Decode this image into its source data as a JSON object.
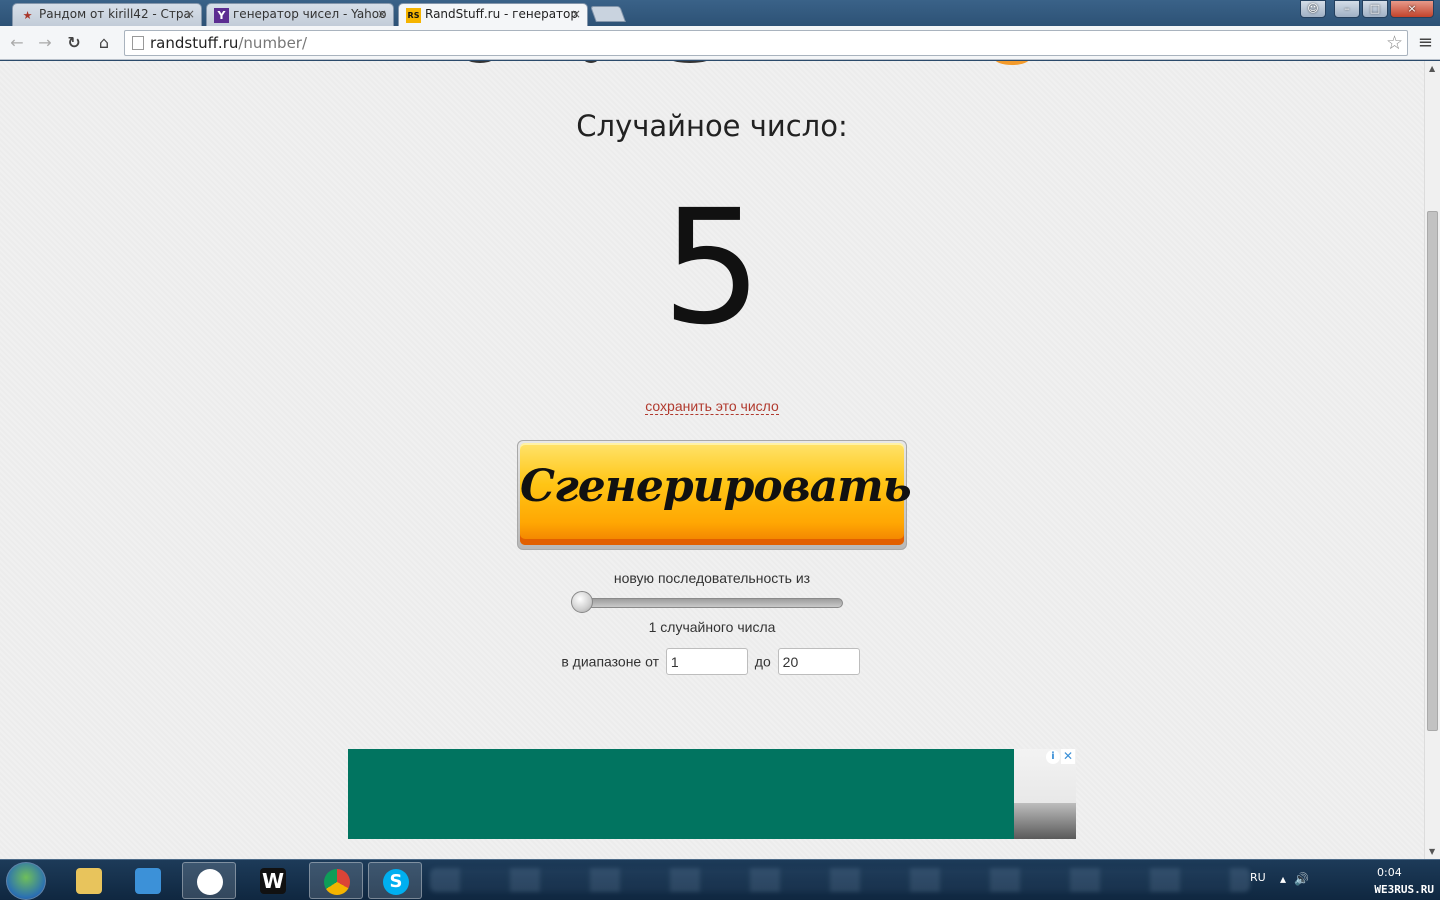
{
  "browser": {
    "tabs": [
      {
        "title": "Рандом от kirill42 - Стра",
        "favicon": "star-icon",
        "active": false
      },
      {
        "title": "генератор чисел - Yahoo",
        "favicon": "Y",
        "active": false
      },
      {
        "title": "RandStuff.ru - генератор",
        "favicon": "RS",
        "active": true
      }
    ],
    "tab_close": "×",
    "url_host": "randstuff.ru",
    "url_path": "/number/",
    "window_controls": {
      "minimize": "–",
      "maximize": "□",
      "close": "×"
    }
  },
  "page": {
    "heading": "Случайное число:",
    "number": "5",
    "save_link": "сохранить это число",
    "generate_button": "Сгенерировать",
    "sequence_label": "новую последовательность из",
    "count_label": "1 случайного числа",
    "slider": {
      "value": 1
    },
    "range": {
      "from_label": "в диапазоне от",
      "from_value": "1",
      "to_label": "до",
      "to_value": "20"
    },
    "ad": {
      "info": "i",
      "close": "✕"
    }
  },
  "taskbar": {
    "w_app": "W",
    "skype": "S",
    "lang": "RU",
    "clock": "0:04",
    "watermark": "WE3RUS.RU"
  },
  "colors": {
    "accent_orange": "#ffb000",
    "link_red": "#b13a2e",
    "ad_green": "#017460"
  }
}
